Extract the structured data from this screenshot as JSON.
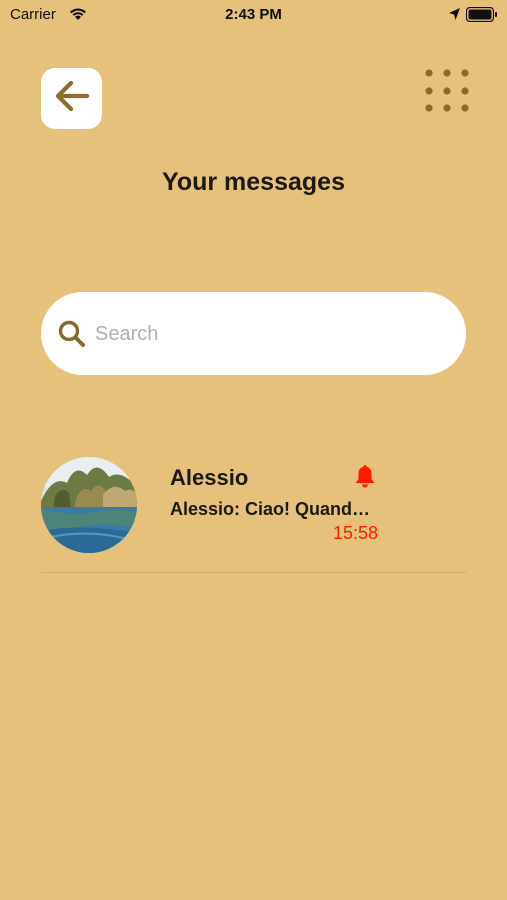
{
  "status_bar": {
    "carrier": "Carrier",
    "time": "2:43 PM"
  },
  "header": {
    "title": "Your messages",
    "back_icon": "arrow-left-icon",
    "menu_icon": "grid-dots-icon"
  },
  "search": {
    "placeholder": "Search",
    "value": "",
    "icon": "search-icon"
  },
  "conversations": [
    {
      "name": "Alessio",
      "last_message": "Alessio: Ciao! Quando ci vediamo?",
      "time": "15:58",
      "notification_icon": "bell-icon"
    }
  ],
  "colors": {
    "background": "#e5c17b",
    "accent": "#8a6a2a",
    "unread": "#ff1a00",
    "title": "#1e1a12"
  }
}
